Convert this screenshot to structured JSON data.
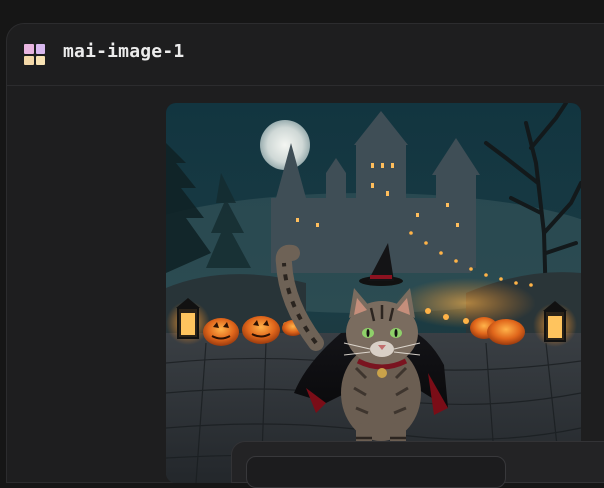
{
  "app": {
    "title": "mai-image-1",
    "icon": "mai-image-app-icon"
  },
  "image": {
    "description_icon": "generated-image",
    "colors": {
      "sky": "#0e2a33",
      "castle": "#3a4a52",
      "pumpkin": "#d9601b"
    }
  }
}
